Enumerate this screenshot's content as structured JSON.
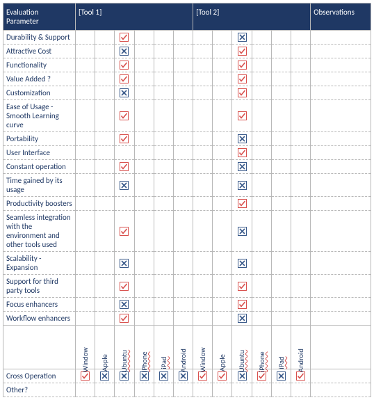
{
  "header": {
    "param": "Evaluation Parameter",
    "tool1": "[Tool 1]",
    "tool2": "[Tool 2]",
    "obs": "Observations"
  },
  "params": [
    "Durability & Support",
    "Attractive Cost",
    "Functionality",
    "Value Added ?",
    "Customization",
    "Ease of Usage - Smooth Learning curve",
    "Portability",
    "User Interface",
    "Constant operation",
    "Time gained by its usage",
    "Productivity boosters",
    "Seamless integration with the environment and other tools used",
    "Scalability - Expansion",
    "Support for third party tools",
    "Focus enhancers",
    "Workflow enhancers"
  ],
  "marks": {
    "tool1": [
      "check",
      "cross",
      "check",
      "check",
      "cross",
      "check",
      "check",
      "",
      "check",
      "cross",
      "",
      "check",
      "cross",
      "check",
      "cross",
      "check"
    ],
    "tool2": [
      "cross",
      "check",
      "check",
      "check",
      "check",
      "check",
      "cross",
      "check",
      "cross",
      "cross",
      "check",
      "cross",
      "cross",
      "check",
      "check",
      "cross"
    ]
  },
  "platforms": [
    "Window",
    "Apple",
    "Ubuntu",
    "iPhone",
    "iPad",
    "Android"
  ],
  "platform_squiggle": [
    false,
    false,
    true,
    true,
    true,
    false
  ],
  "bottom_rows": {
    "cross_op": {
      "label": "Cross Operation",
      "tool1": [
        "check",
        "cross",
        "cross",
        "cross",
        "cross",
        "cross"
      ],
      "tool2": [
        "check",
        "check",
        "cross",
        "check",
        "cross",
        "check"
      ]
    },
    "other": {
      "label": "Other?",
      "tool1": [
        "",
        "",
        "",
        "",
        "",
        ""
      ],
      "tool2": [
        "",
        "",
        "",
        "",
        "",
        ""
      ]
    }
  }
}
